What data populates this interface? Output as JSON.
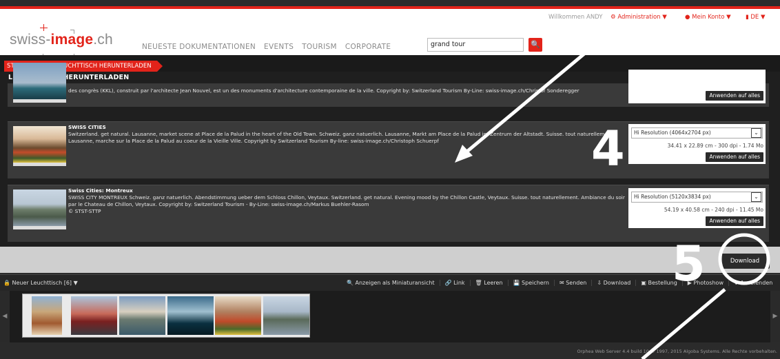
{
  "header": {
    "logo": "swiss-image.ch",
    "nav": [
      "NEUESTE DOKUMENTATIONEN",
      "EVENTS",
      "TOURISM",
      "CORPORATE"
    ],
    "search_value": "grand tour",
    "welcome": "Willkommen ANDY",
    "admin_label": "Administration ▼",
    "account_label": "Mein Konto ▼",
    "lang_label": "DE ▼"
  },
  "breadcrumb": [
    "STARTSEITE",
    "LEUCHTTISCH HERUNTERLADEN"
  ],
  "page_title": "LEUCHTTISCH HERUNTERLADEN",
  "rows": [
    {
      "title": "",
      "text": "des congrès (KKL), construit par l'architecte Jean Nouvel, est un des monuments d'architecture contemporaine de la ville. Copyright by: Switzerland Tourism By-Line: swiss-image.ch/Christof Sonderegger",
      "apply": "Anwenden auf alles"
    },
    {
      "title": "SWISS CITIES",
      "text": "Switzerland. get natural. Lausanne, market scene at Place de la Palud in the heart of the Old Town. Schweiz. ganz natuerlich. Lausanne, Markt am Place de la Palud im Zentrum der Altstadt. Suisse. tout naturellement. Lausanne, marche sur la Place de la Palud au coeur de la Vieille Ville. Copyright by Switzerland Tourism By-line: swiss-image.ch/Christoph Schuerpf",
      "resolution": "Hi Resolution (4064x2704 px)",
      "dims": "34.41 x 22.89 cm - 300 dpi - 1.74 Mo",
      "apply": "Anwenden auf alles"
    },
    {
      "title": "Swiss Cities: Montreux",
      "text": "SWISS CITY MONTREUX Schweiz. ganz natuerlich. Abendstimmung ueber dem Schloss Chillon, Veytaux. Switzerland. get natural. Evening mood by the Chillon Castle, Veytaux. Suisse. tout naturellement. Ambiance du soir par le Chateau de Chillon, Veytaux. Copyright by: Switzerland Tourism - By-Line: swiss-image.ch/Markus Buehler-Rasom",
      "extra": "© STST-STTP",
      "resolution": "Hi Resolution (5120x3834 px)",
      "dims": "54.19 x 40.58 cm - 240 dpi - 11.45 Mo",
      "apply": "Anwenden auf alles"
    }
  ],
  "download_label": "Download",
  "lightbox": {
    "name": "Neuer Leuchttisch [6] ▼",
    "tools": [
      "Anzeigen als Miniaturansicht",
      "Link",
      "Leeren",
      "Speichern",
      "Senden",
      "Download",
      "Bestellung",
      "Photoshow",
      "Ausblenden"
    ]
  },
  "footer": "Orphea Web Server 4.4 build 10 © 1997, 2015 Algoba Systems. Alle Rechte vorbehalten.",
  "annotations": [
    "4",
    "5"
  ]
}
